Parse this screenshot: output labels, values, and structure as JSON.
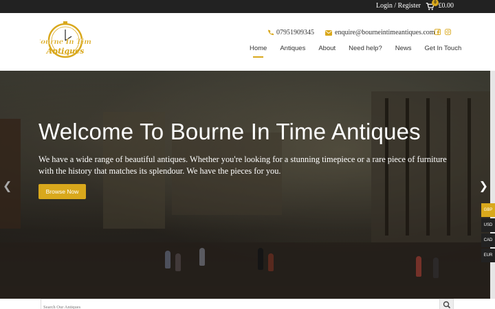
{
  "topbar": {
    "login_label": "Login / Register",
    "cart_count": "0",
    "cart_total": "£0.00"
  },
  "header": {
    "logo_text_line1": "Bourne In Time",
    "logo_text_line2": "Antiques",
    "phone": "07951909345",
    "email": "enquire@bourneintimeantiques.com",
    "nav": [
      "Home",
      "Antiques",
      "About",
      "Need help?",
      "News",
      "Get In Touch"
    ]
  },
  "hero": {
    "title": "Welcome To Bourne In Time Antiques",
    "body": "We have a wide range of beautiful antiques. Whether you're looking for a stunning timepiece or a rare piece of furniture with the history that matches its splendour. We have the pieces for you.",
    "button_label": "Browse Now"
  },
  "currency": {
    "options": [
      "GBP",
      "USD",
      "CAD",
      "EUR"
    ],
    "selected": "GBP"
  },
  "search": {
    "placeholder": "Search Our Antiques"
  },
  "colors": {
    "accent": "#d9a81c",
    "topbar": "#222222"
  }
}
